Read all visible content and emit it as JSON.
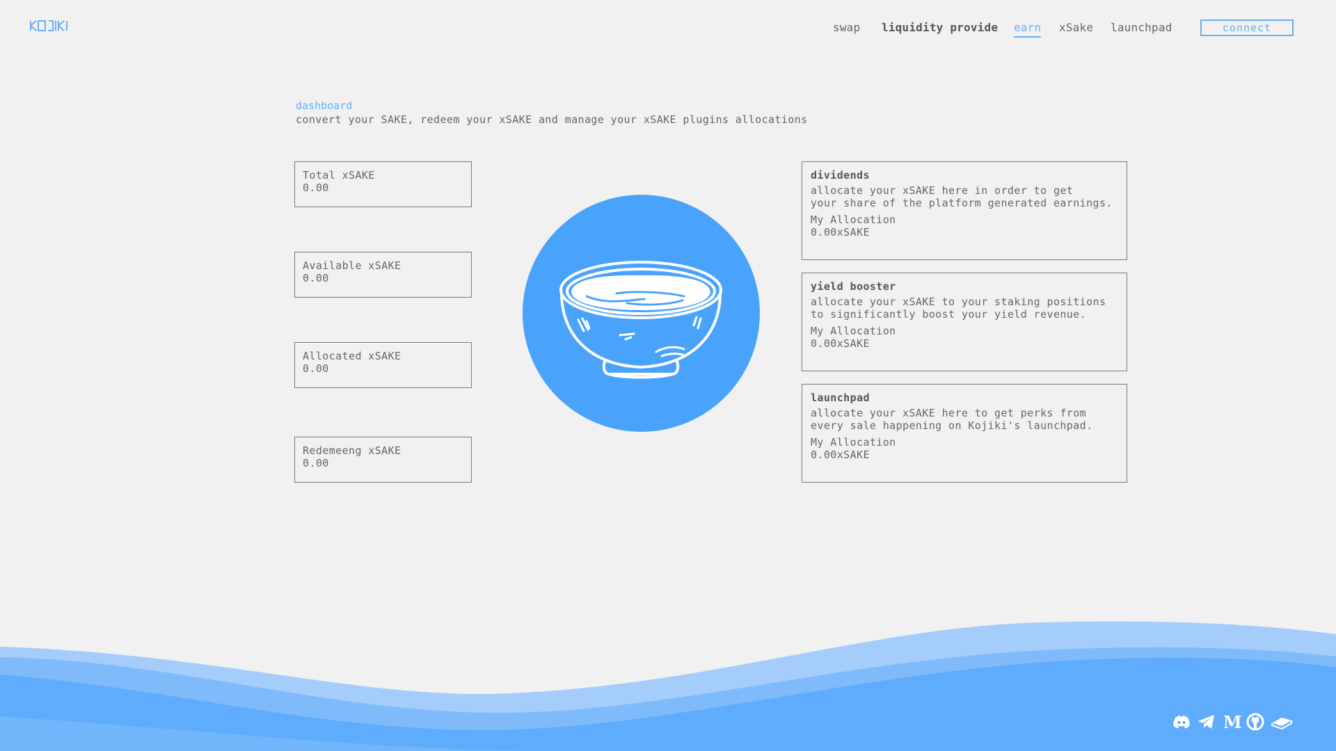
{
  "header": {
    "logo_text": "KOJIKI",
    "nav": [
      {
        "label": "swap"
      },
      {
        "label": "liquidity provide"
      },
      {
        "label": "earn"
      },
      {
        "label": "xSake"
      },
      {
        "label": "launchpad"
      }
    ],
    "connect_label": "connect"
  },
  "page": {
    "breadcrumb": "dashboard",
    "subtitle": "convert your SAKE, redeem your xSAKE and manage your xSAKE plugins allocations"
  },
  "stats": [
    {
      "label": "Total xSAKE",
      "value": "0.00"
    },
    {
      "label": "Available xSAKE",
      "value": "0.00"
    },
    {
      "label": "Allocated xSAKE",
      "value": "0.00"
    },
    {
      "label": "Redemeeng xSAKE",
      "value": "0.00"
    }
  ],
  "plugins": [
    {
      "title": "dividends",
      "desc_line1": "allocate your xSAKE here in order to get",
      "desc_line2": "your share of the platform generated earnings.",
      "alloc_label": "My Allocation",
      "alloc_value": "0.00xSAKE"
    },
    {
      "title": "yield booster",
      "desc_line1": "allocate your xSAKE to your staking positions",
      "desc_line2": "to significantly boost your yield revenue.",
      "alloc_label": "My Allocation",
      "alloc_value": "0.00xSAKE"
    },
    {
      "title": "launchpad",
      "desc_line1": "allocate your xSAKE here to get perks from",
      "desc_line2": "every sale happening on Kojiki's launchpad.",
      "alloc_label": "My Allocation",
      "alloc_value": "0.00xSAKE"
    }
  ],
  "footer": {
    "socials": [
      "discord-icon",
      "telegram-icon",
      "medium-icon",
      "github-icon",
      "docs-icon"
    ]
  },
  "colors": {
    "accent": "#6aaef5",
    "bowl_bg": "#4aa3fb",
    "background": "#f1f1f1"
  }
}
